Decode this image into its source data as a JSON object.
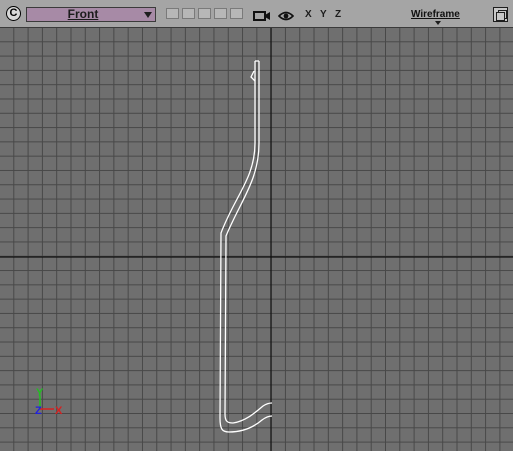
{
  "toolbar": {
    "menu_button_label": "C",
    "view_name": "Front",
    "axis_labels": [
      "X",
      "Y",
      "Z"
    ],
    "shading_mode": "Wireframe",
    "icons": {
      "menu": "viewport-menu-icon",
      "camera": "camera-icon",
      "eye": "eye-icon",
      "maximize": "maximize-icon",
      "dropdown": "chevron-down-icon"
    }
  },
  "viewport": {
    "axis_gizmo_labels": {
      "y": "Y",
      "z": "Z",
      "x": "X"
    },
    "colors": {
      "background": "#6f6f6f",
      "grid": "#484848",
      "origin_axes": "#101010",
      "wireframe": "#ffffff",
      "gizmo_x": "#d62020",
      "gizmo_y": "#20c020",
      "gizmo_z": "#2020e0"
    }
  }
}
